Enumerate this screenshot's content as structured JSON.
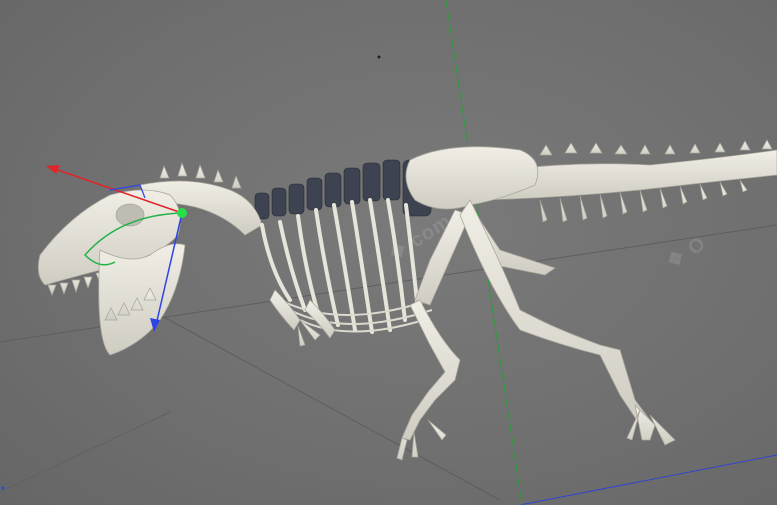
{
  "viewport": {
    "title": "",
    "background": "#6f6f6f",
    "bone_color": "#e9e6dc",
    "bone_shadow": "#b8b5aa",
    "vertebra_dark": "#3d4350",
    "grid_line_color": "#5c5c5c"
  },
  "axes": {
    "x_color": "#e0252a",
    "y_color": "#26b14a",
    "z_color": "#2c44e6"
  },
  "model": {
    "icon": "t-rex-skeleton-icon"
  }
}
